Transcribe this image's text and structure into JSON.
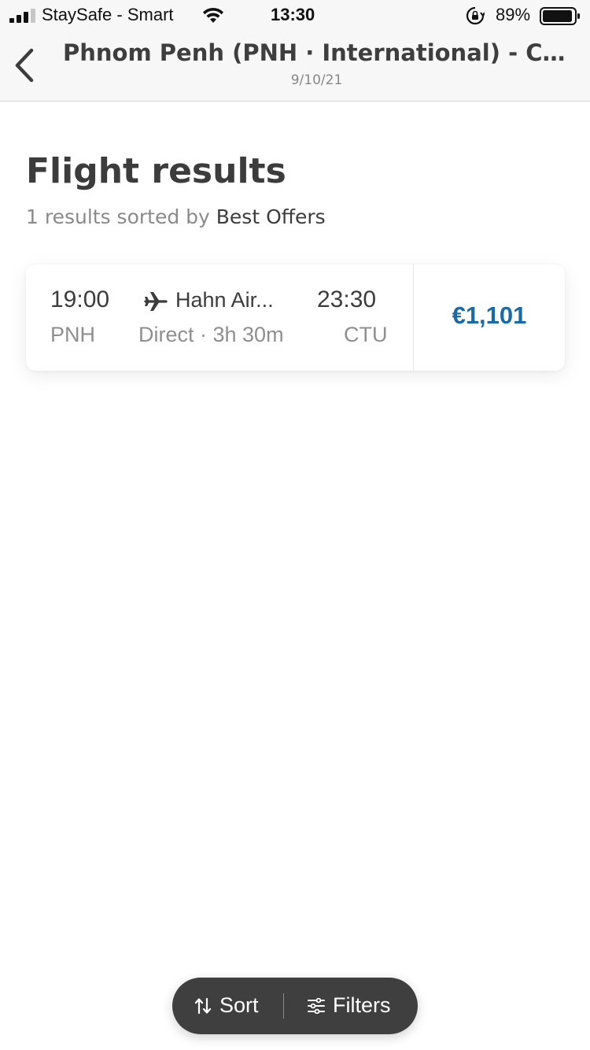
{
  "status_bar": {
    "carrier": "StaySafe - Smart",
    "time": "13:30",
    "battery": "89%",
    "icons": [
      "signal-icon",
      "wifi-icon",
      "orientation-lock-icon",
      "battery-icon"
    ]
  },
  "header": {
    "title": "Phnom Penh (PNH · International) - Chengdu",
    "date": "9/10/21",
    "back_icon": "chevron-left-icon"
  },
  "main": {
    "title": "Flight results",
    "summary_prefix": "1 results sorted by ",
    "sort_value": "Best Offers",
    "results": [
      {
        "departure_time": "19:00",
        "departure_code": "PNH",
        "airline": "Hahn Air...",
        "info": "Direct · 3h 30m",
        "arrival_time": "23:30",
        "arrival_code": "CTU",
        "price": "€1,101"
      }
    ]
  },
  "actions": {
    "sort_label": "Sort",
    "filters_label": "Filters"
  },
  "colors": {
    "price": "#1a6aa8",
    "pill_background": "#3f3f3f",
    "text_primary": "#3c3c3c",
    "text_secondary": "#8f8f8f"
  }
}
